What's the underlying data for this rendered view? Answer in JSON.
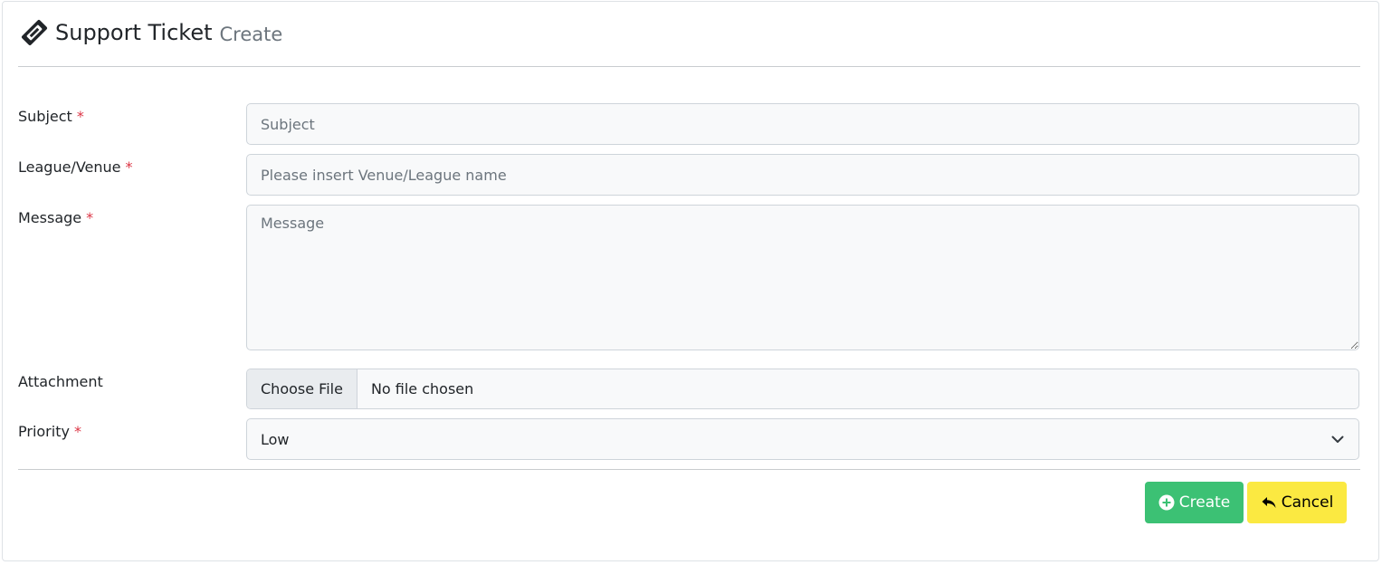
{
  "header": {
    "icon": "ticket-icon",
    "title": "Support Ticket",
    "subtitle": "Create"
  },
  "form": {
    "required_marker": "*",
    "subject": {
      "label": "Subject",
      "placeholder": "Subject",
      "value": ""
    },
    "league": {
      "label": "League/Venue",
      "placeholder": "Please insert Venue/League name",
      "value": ""
    },
    "message": {
      "label": "Message",
      "placeholder": "Message",
      "value": ""
    },
    "attachment": {
      "label": "Attachment",
      "button": "Choose File",
      "status": "No file chosen"
    },
    "priority": {
      "label": "Priority",
      "selected": "Low",
      "icon": "chevron-down-icon"
    }
  },
  "actions": {
    "create_label": "Create",
    "create_icon": "plus-circle-icon",
    "cancel_label": "Cancel",
    "cancel_icon": "reply-icon",
    "create_color": "#3cc174",
    "cancel_color": "#fbe941"
  }
}
